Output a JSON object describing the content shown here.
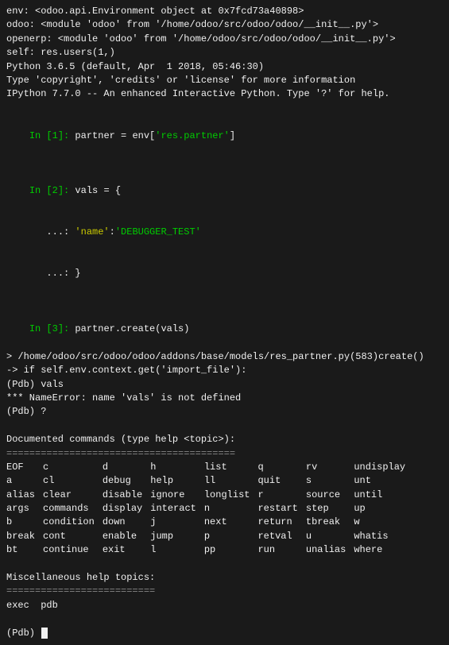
{
  "terminal": {
    "lines": [
      {
        "text": "env: <odoo.api.Environment object at 0x7fcd73a40898>",
        "color": "white"
      },
      {
        "text": "odoo: <module 'odoo' from '/home/odoo/src/odoo/odoo/__init__.py'>",
        "color": "white"
      },
      {
        "text": "openerp: <module 'odoo' from '/home/odoo/src/odoo/odoo/__init__.py'>",
        "color": "white"
      },
      {
        "text": "self: res.users(1,)",
        "color": "white"
      },
      {
        "text": "Python 3.6.5 (default, Apr  1 2018, 05:46:30)",
        "color": "white"
      },
      {
        "text": "Type 'copyright', 'credits' or 'license' for more information",
        "color": "white"
      },
      {
        "text": "IPython 7.7.0 -- An enhanced Interactive Python. Type '?' for help.",
        "color": "white"
      }
    ],
    "in1": {
      "prompt": "In [1]:",
      "code": " partner = env[",
      "string": "'res.partner'",
      "code2": "]"
    },
    "in2": {
      "prompt": "In [2]:",
      "code": " vals = {",
      "line2": "   ...: ",
      "key": "'name'",
      "sep": ":",
      "val": "'DEBUGGER_TEST'",
      "line3": "   ...: }"
    },
    "in3": {
      "prompt": "In [3]:",
      "code": " partner.create(vals)"
    },
    "trace": [
      "> /home/odoo/src/odoo/odoo/addons/base/models/res_partner.py(583)create()",
      "-> if self.env.context.get('import_file'):",
      "(Pdb) vals",
      "*** NameError: name 'vals' is not defined",
      "(Pdb) ?"
    ],
    "doc_header": "Documented commands (type help <topic>):",
    "separator1": "========================================",
    "commands": {
      "cols": [
        [
          "EOF",
          "a",
          "alias",
          "args",
          "b",
          "break",
          "bt"
        ],
        [
          "c",
          "cl",
          "clear",
          "commands",
          "condition",
          "cont",
          "continue"
        ],
        [
          "d",
          "debug",
          "disable",
          "display",
          "down",
          "enable",
          "exit"
        ],
        [
          "h",
          "help",
          "ignore",
          "interact",
          "j",
          "jump",
          "l"
        ],
        [
          "list",
          "ll",
          "longlist",
          "n",
          "next",
          "p",
          "pp"
        ],
        [
          "q",
          "quit",
          "r",
          "restart",
          "return",
          "retval",
          "run"
        ],
        [
          "rv",
          "s",
          "source",
          "step",
          "tbreak",
          "u",
          "unalias"
        ],
        [
          "undisplay",
          "unt",
          "until",
          "up",
          "w",
          "whatis",
          "where"
        ]
      ]
    },
    "misc_header": "Miscellaneous help topics:",
    "separator2": "==========================",
    "misc_items": "exec  pdb",
    "pdb_prompt": "(Pdb) "
  }
}
